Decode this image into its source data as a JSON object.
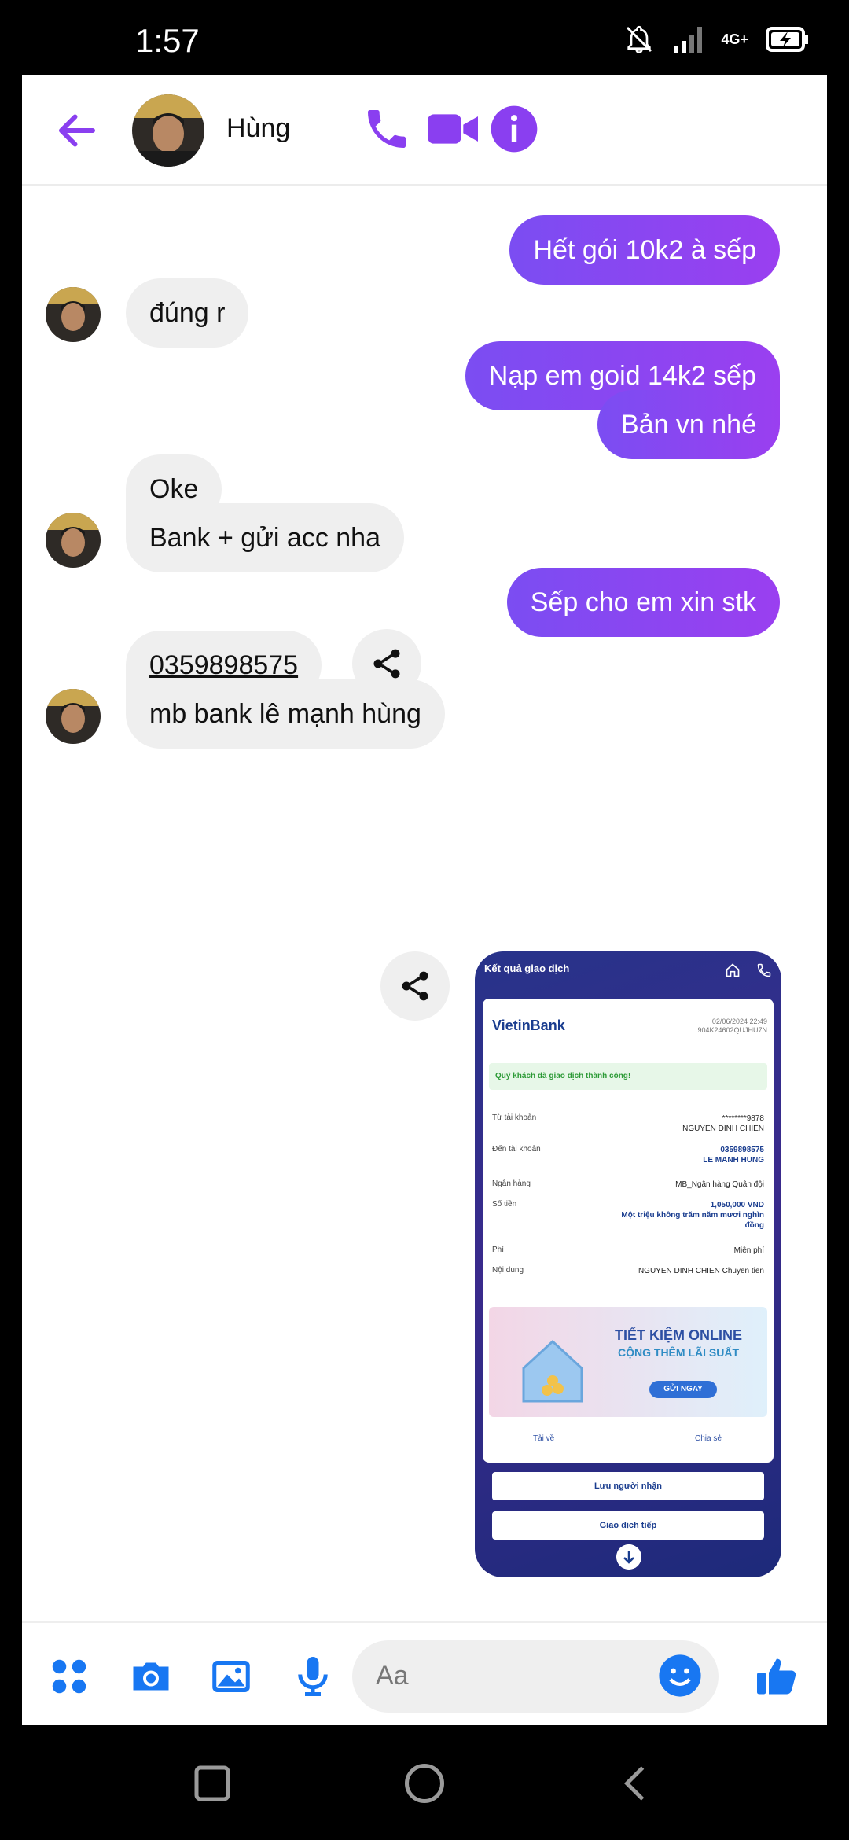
{
  "status_bar": {
    "time": "1:57",
    "network": "4G+"
  },
  "header": {
    "contact_name": "Hùng",
    "accent": "#8a3ff0"
  },
  "messages": [
    {
      "dir": "out",
      "text": "Hết gói 10k2 à sếp"
    },
    {
      "dir": "in",
      "text": "đúng r"
    },
    {
      "dir": "out",
      "text": "Nạp em goid 14k2 sếp"
    },
    {
      "dir": "out",
      "text": "Bản vn nhé"
    },
    {
      "dir": "in",
      "text": "Oke"
    },
    {
      "dir": "in",
      "text": "Bank + gửi acc nha"
    },
    {
      "dir": "out",
      "text": "Sếp cho em xin stk"
    },
    {
      "dir": "in",
      "text": "0359898575"
    },
    {
      "dir": "in",
      "text": "mb bank lê mạnh hùng"
    }
  ],
  "receipt": {
    "title": "Kết quả giao dịch",
    "bank_logo": "VietinBank",
    "datetime": "02/06/2024 22:49",
    "ref": "904K24602QUJHU7N",
    "success": "Quý khách đã giao dịch thành công!",
    "from_label": "Từ tài khoản",
    "from_account": "********9878",
    "from_name": "NGUYEN DINH CHIEN",
    "to_label": "Đến tài khoản",
    "to_account": "0359898575",
    "to_name": "LE MANH HUNG",
    "bank_label": "Ngân hàng",
    "bank_value": "MB_Ngân hàng Quân đội",
    "amount_label": "Số tiền",
    "amount": "1,050,000 VND",
    "amount_words": "Một triệu không trăm năm mươi nghìn đồng",
    "fee_label": "Phí",
    "fee": "Miễn phí",
    "content_label": "Nội dung",
    "content": "NGUYEN DINH CHIEN Chuyen tien",
    "promo_line1": "TIẾT KIỆM ONLINE",
    "promo_line2": "CỘNG THÊM LÃI SUẤT",
    "promo_button": "GỬI NGAY",
    "download": "Tải về",
    "share": "Chia sẻ",
    "save_recipient": "Lưu người nhận",
    "continue": "Giao dịch tiếp"
  },
  "composer": {
    "placeholder": "Aa",
    "icon_color": "#1877f2"
  },
  "icons": {
    "back": "back-arrow-icon",
    "call": "phone-icon",
    "video": "video-icon",
    "info": "info-icon",
    "share": "share-icon",
    "apps": "apps-grid-icon",
    "camera": "camera-icon",
    "gallery": "image-icon",
    "mic": "microphone-icon",
    "emoji": "emoji-icon",
    "like": "thumbs-up-icon"
  }
}
